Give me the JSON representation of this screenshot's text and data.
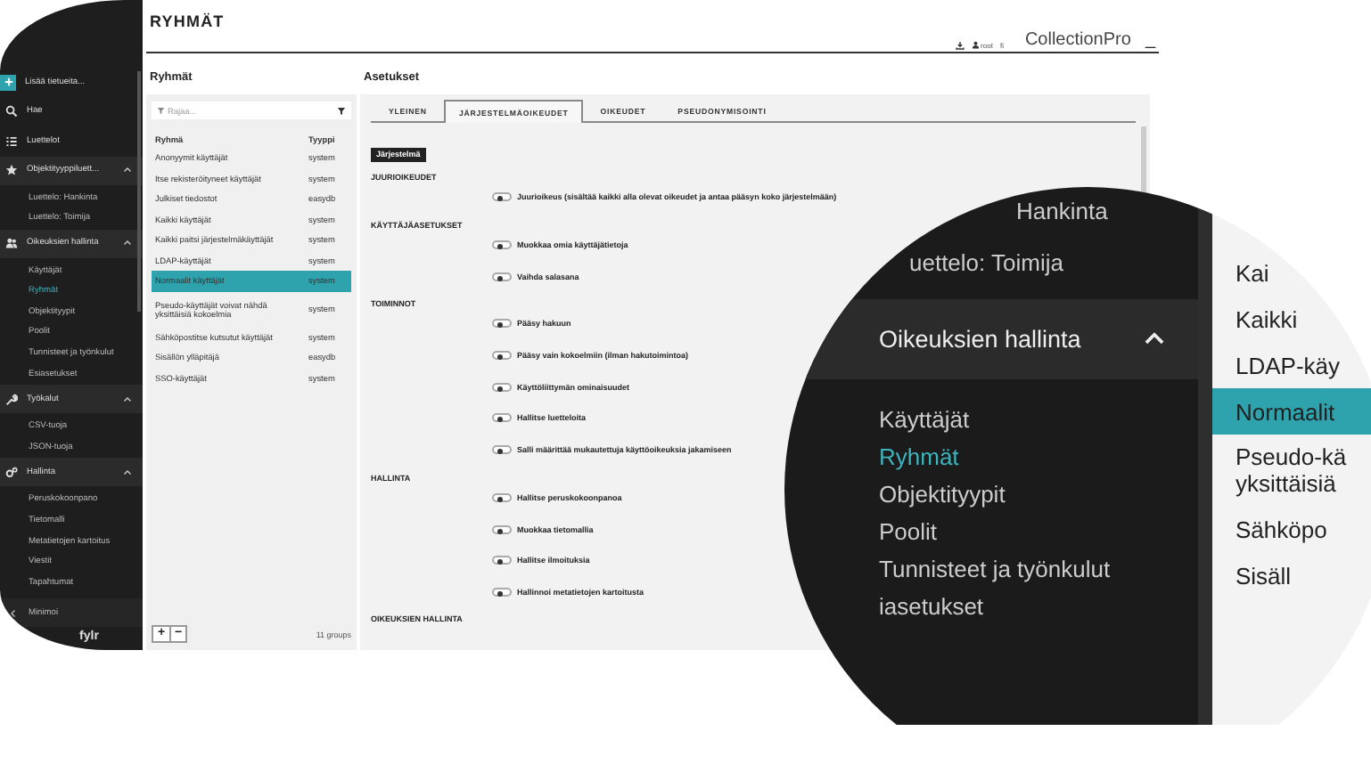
{
  "header": {
    "title": "RYHMÄT",
    "user": "root",
    "language": "fi",
    "brand": "CollectionPro",
    "minimize": "_"
  },
  "sidebar": {
    "items": [
      {
        "kind": "action",
        "label": "Lisää tietueita..."
      },
      {
        "kind": "link",
        "label": "Hae"
      },
      {
        "kind": "link",
        "label": "Luettelot"
      },
      {
        "kind": "section",
        "label": "Objektityyppiluett...",
        "expanded": true,
        "children": [
          {
            "label": "Luettelo: Hankinta",
            "selected": false
          },
          {
            "label": "Luettelo: Toimija",
            "selected": false
          }
        ]
      },
      {
        "kind": "section",
        "label": "Oikeuksien hallinta",
        "expanded": true,
        "children": [
          {
            "label": "Käyttäjät",
            "selected": false
          },
          {
            "label": "Ryhmät",
            "selected": true
          },
          {
            "label": "Objektityypit",
            "selected": false
          },
          {
            "label": "Poolit",
            "selected": false
          },
          {
            "label": "Tunnisteet ja työnkulut",
            "selected": false
          },
          {
            "label": "Esiasetukset",
            "selected": false
          }
        ]
      },
      {
        "kind": "section",
        "label": "Työkalut",
        "expanded": true,
        "children": [
          {
            "label": "CSV-tuoja",
            "selected": false
          },
          {
            "label": "JSON-tuoja",
            "selected": false
          }
        ]
      },
      {
        "kind": "section",
        "label": "Hallinta",
        "expanded": true,
        "children": [
          {
            "label": "Peruskokoonpano",
            "selected": false
          },
          {
            "label": "Tietomalli",
            "selected": false
          },
          {
            "label": "Metatietojen kartoitus",
            "selected": false
          },
          {
            "label": "Viestit",
            "selected": false
          },
          {
            "label": "Tapahtumat",
            "selected": false
          }
        ]
      }
    ],
    "minimize": "Minimoi",
    "logo": "fylr"
  },
  "groups": {
    "title": "Ryhmät",
    "filter": {
      "placeholder": "Rajaa..."
    },
    "columns": [
      "Ryhmä",
      "Tyyppi"
    ],
    "rows": [
      {
        "name": "Anonyymit käyttäjät",
        "type": "system",
        "selected": false
      },
      {
        "name": "Itse rekisteröityneet käyttäjät",
        "type": "system",
        "selected": false
      },
      {
        "name": "Julkiset tiedostot",
        "type": "easydb",
        "selected": false
      },
      {
        "name": "Kaikki käyttäjät",
        "type": "system",
        "selected": false
      },
      {
        "name": "Kaikki paitsi järjestelmäkäyttäjät",
        "type": "system",
        "selected": false
      },
      {
        "name": "LDAP-käyttäjät",
        "type": "system",
        "selected": false
      },
      {
        "name": "Normaalit käyttäjät",
        "type": "system",
        "selected": true
      },
      {
        "name": "Pseudo-käyttäjät voivat nähdä yksittäisiä kokoelmia",
        "type": "system",
        "selected": false
      },
      {
        "name": "Sähköpostitse kutsutut käyttäjät",
        "type": "system",
        "selected": false
      },
      {
        "name": "Sisällön ylläpitäjä",
        "type": "easydb",
        "selected": false
      },
      {
        "name": "SSO-käyttäjät",
        "type": "system",
        "selected": false
      }
    ],
    "buttons": [
      "+",
      "−"
    ],
    "count": "11 groups"
  },
  "settings": {
    "title": "Asetukset",
    "tabs": [
      {
        "label": "YLEINEN",
        "selected": false
      },
      {
        "label": "JÄRJESTELMÄOIKEUDET",
        "selected": true
      },
      {
        "label": "OIKEUDET",
        "selected": false
      },
      {
        "label": "PSEUDONYMISOINTI",
        "selected": false
      }
    ],
    "badge": "Järjestelmä",
    "sections": [
      {
        "title": "JUURIOIKEUDET",
        "options": [
          {
            "label": "Juurioikeus (sisältää kaikki alla olevat oikeudet ja antaa pääsyn koko järjestelmään)",
            "on": false
          }
        ]
      },
      {
        "title": "KÄYTTÄJÄASETUKSET",
        "options": [
          {
            "label": "Muokkaa omia käyttäjätietoja",
            "on": false
          },
          {
            "label": "Vaihda salasana",
            "on": false
          }
        ]
      },
      {
        "title": "TOIMINNOT",
        "options": [
          {
            "label": "Pääsy hakuun",
            "on": false
          },
          {
            "label": "Pääsy vain kokoelmiin (ilman hakutoimintoa)",
            "on": false
          },
          {
            "label": "Käyttöliittymän ominaisuudet",
            "on": false
          },
          {
            "label": "Hallitse luetteloita",
            "on": false
          },
          {
            "label": "Salli määrittää mukautettuja käyttöoikeuksia jakamiseen",
            "on": false
          }
        ]
      },
      {
        "title": "HALLINTA",
        "options": [
          {
            "label": "Hallitse peruskokoonpanoa",
            "on": false
          },
          {
            "label": "Muokkaa tietomallia",
            "on": false
          },
          {
            "label": "Hallitse ilmoituksia",
            "on": false
          },
          {
            "label": "Hallinnoi metatietojen kartoitusta",
            "on": false
          }
        ]
      },
      {
        "title": "OIKEUKSIEN HALLINTA"
      }
    ]
  },
  "magnifier": {
    "sidebar_items": [
      {
        "kind": "child",
        "label": "Hankinta",
        "selected": false
      },
      {
        "kind": "child",
        "label": "uettelo: Toimija",
        "selected": false
      },
      {
        "kind": "section",
        "label": "Oikeuksien hallinta",
        "expanded": true
      },
      {
        "kind": "child",
        "label": "Käyttäjät",
        "selected": false
      },
      {
        "kind": "child",
        "label": "Ryhmät",
        "selected": true
      },
      {
        "kind": "child",
        "label": "Objektityypit",
        "selected": false
      },
      {
        "kind": "child",
        "label": "Poolit",
        "selected": false
      },
      {
        "kind": "child",
        "label": "Tunnisteet ja työnkulut",
        "selected": false
      },
      {
        "kind": "child",
        "label": "iasetukset",
        "selected": false
      }
    ],
    "group_rows": [
      {
        "lines": [
          "Kai"
        ],
        "selected": false
      },
      {
        "lines": [
          "Kaikki"
        ],
        "selected": false
      },
      {
        "lines": [
          "LDAP-käy"
        ],
        "selected": false
      },
      {
        "lines": [
          "Normaalit"
        ],
        "selected": true
      },
      {
        "lines": [
          "Pseudo-kä",
          "yksittäisiä"
        ],
        "selected": false
      },
      {
        "lines": [
          "Sähköpo"
        ],
        "selected": false
      },
      {
        "lines": [
          "Sisäll"
        ],
        "selected": false
      }
    ]
  }
}
